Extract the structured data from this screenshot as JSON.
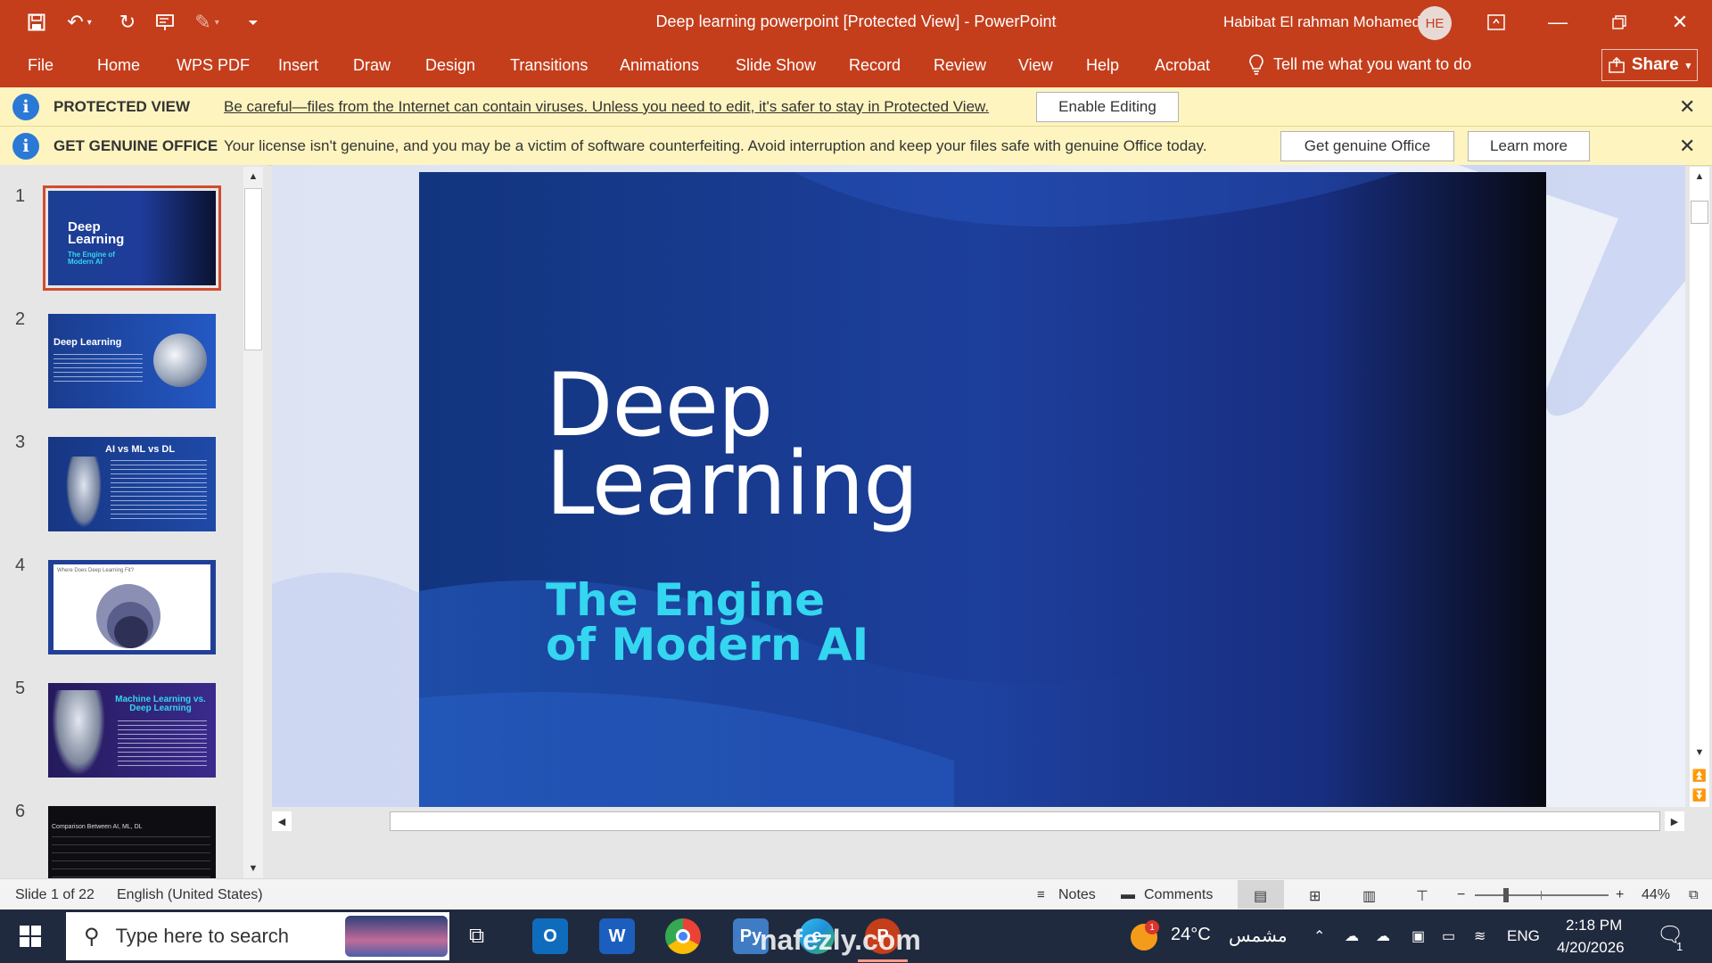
{
  "titlebar": {
    "document_title": "Deep learning powerpoint [Protected View]  -  PowerPoint",
    "user_name": "Habibat El rahman Mohamed",
    "user_initials": "HE"
  },
  "menu": {
    "items": [
      "File",
      "Home",
      "WPS PDF",
      "Insert",
      "Draw",
      "Design",
      "Transitions",
      "Animations",
      "Slide Show",
      "Record",
      "Review",
      "View",
      "Help",
      "Acrobat"
    ],
    "tell_me": "Tell me what you want to do",
    "share": "Share"
  },
  "protected_bar": {
    "title": "PROTECTED VIEW",
    "message": "Be careful—files from the Internet can contain viruses. Unless you need to edit, it's safer to stay in Protected View.",
    "button": "Enable Editing"
  },
  "genuine_bar": {
    "title": "GET GENUINE OFFICE",
    "message": "Your license isn't genuine, and you may be a victim of software counterfeiting. Avoid interruption and keep your files safe with genuine Office today.",
    "button1": "Get genuine Office",
    "button2": "Learn more"
  },
  "thumbnails": [
    {
      "num": "1",
      "title": "Deep Learning",
      "sub": "The Engine of Modern AI"
    },
    {
      "num": "2",
      "title": "Deep Learning"
    },
    {
      "num": "3",
      "title": "AI vs ML vs DL"
    },
    {
      "num": "4",
      "title": "Where Does Deep Learning Fit?"
    },
    {
      "num": "5",
      "title": "Machine Learning vs. Deep Learning"
    },
    {
      "num": "6",
      "title": "Comparison Between AI, ML, DL"
    }
  ],
  "slide": {
    "title_line1": "Deep",
    "title_line2": "Learning",
    "subtitle_line1": "The Engine",
    "subtitle_line2": "of Modern AI"
  },
  "status": {
    "slide_counter": "Slide 1 of 22",
    "language": "English (United States)",
    "notes": "Notes",
    "comments": "Comments",
    "zoom": "44%"
  },
  "taskbar": {
    "search_placeholder": "Type here to search",
    "weather_temp": "24°C",
    "weather_desc": "مشمس",
    "weather_badge": "1",
    "language": "ENG",
    "time": "2:18 PM",
    "date": "4/20/2026",
    "notification_count": "1"
  },
  "watermark": {
    "text": "nafezly.com"
  },
  "colors": {
    "accent": "#c43e1c",
    "slide_bg": "#163b86",
    "subtitle": "#34d6f0"
  }
}
